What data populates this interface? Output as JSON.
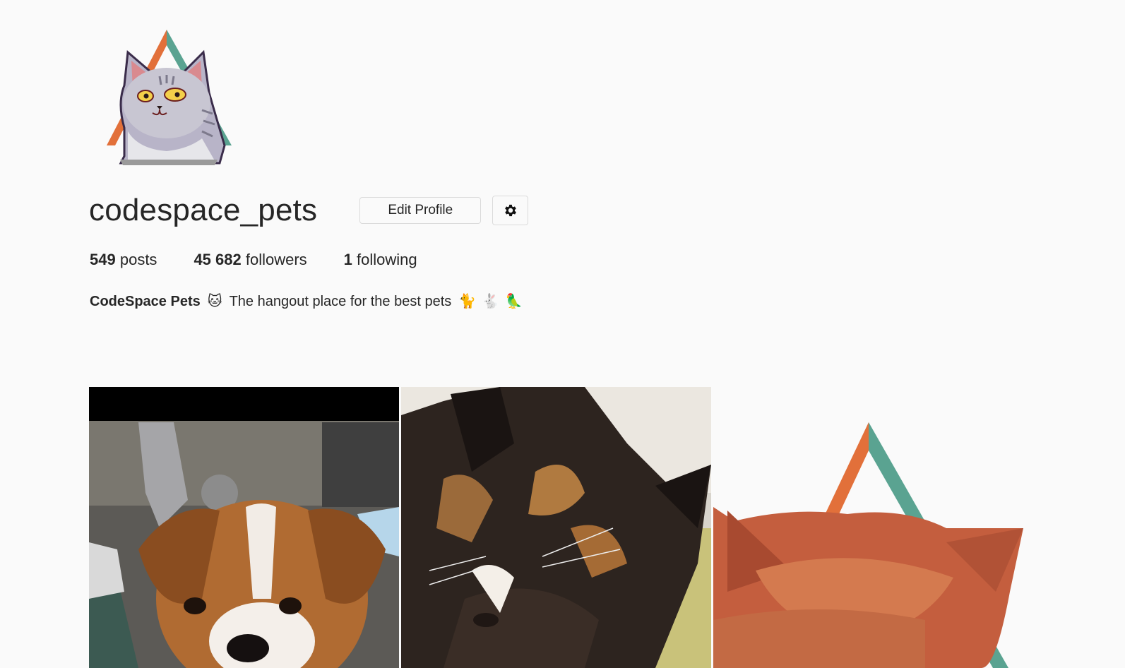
{
  "profile": {
    "username": "codespace_pets",
    "edit_label": "Edit Profile",
    "settings_icon": "gear-icon"
  },
  "stats": {
    "posts_count": "549",
    "posts_label": "posts",
    "followers_count": "45 682",
    "followers_label": "followers",
    "following_count": "1",
    "following_label": "following"
  },
  "bio": {
    "name": "CodeSpace Pets",
    "name_emoji": "🐱",
    "text": "The hangout place for the best pets",
    "emojis": [
      "🐈",
      "🐇",
      "🦜"
    ]
  },
  "posts": [
    {
      "subject": "dog"
    },
    {
      "subject": "calico-cat"
    },
    {
      "subject": "orange-cat"
    }
  ],
  "colors": {
    "background": "#fafafa",
    "border": "#dbdbdb",
    "text": "#262626",
    "logo_orange": "#e2703a",
    "logo_teal": "#5aa391"
  }
}
